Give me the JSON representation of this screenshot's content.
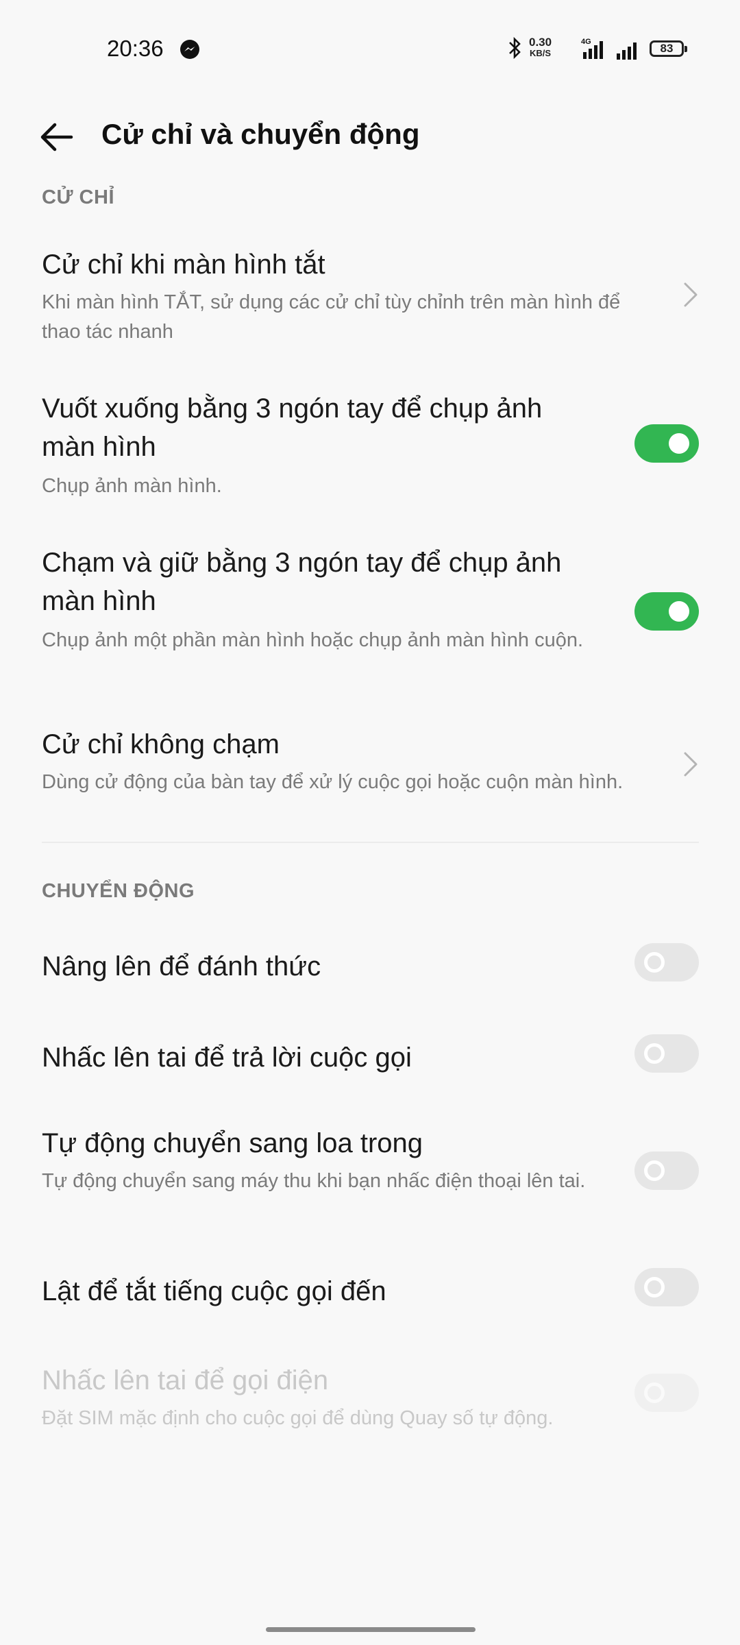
{
  "status_bar": {
    "time": "20:36",
    "net_speed_value": "0.30",
    "net_speed_unit": "KB/S",
    "network_type": "4G",
    "battery": "83",
    "icons": [
      "messenger-icon",
      "bluetooth-icon",
      "signal-icon",
      "signal-icon",
      "battery-icon"
    ]
  },
  "header": {
    "title": "Cử chỉ và chuyển động",
    "back_icon": "arrow-left-icon"
  },
  "sections": {
    "gestures": {
      "label": "CỬ CHỈ",
      "items": [
        {
          "title": "Cử chỉ khi màn hình tắt",
          "subtitle": "Khi màn hình TẮT, sử dụng các cử chỉ tùy chỉnh trên màn hình để thao tác nhanh",
          "control": "chevron"
        },
        {
          "title": "Vuốt xuống bằng 3 ngón tay để chụp ảnh màn hình",
          "subtitle": "Chụp ảnh màn hình.",
          "control": "toggle",
          "enabled": true
        },
        {
          "title": "Chạm và giữ bằng 3 ngón tay để chụp ảnh màn hình",
          "subtitle": "Chụp ảnh một phần màn hình hoặc chụp ảnh màn hình cuộn.",
          "control": "toggle",
          "enabled": true
        },
        {
          "title": "Cử chỉ không chạm",
          "subtitle": "Dùng cử động của bàn tay để xử lý cuộc gọi hoặc cuộn màn hình.",
          "control": "chevron"
        }
      ]
    },
    "motion": {
      "label": "CHUYỂN ĐỘNG",
      "items": [
        {
          "title": "Nâng lên để đánh thức",
          "control": "toggle",
          "enabled": false
        },
        {
          "title": "Nhấc lên tai để trả lời cuộc gọi",
          "control": "toggle",
          "enabled": false
        },
        {
          "title": "Tự động chuyển sang loa trong",
          "subtitle": "Tự động chuyển sang máy thu khi bạn nhấc điện thoại lên tai.",
          "control": "toggle",
          "enabled": false
        },
        {
          "title": "Lật để tắt tiếng cuộc gọi đến",
          "control": "toggle",
          "enabled": false
        },
        {
          "title": "Nhấc lên tai để gọi điện",
          "subtitle": "Đặt SIM mặc định cho cuộc gọi để dùng Quay số tự động.",
          "control": "toggle",
          "enabled": false,
          "disabled": true
        }
      ]
    }
  },
  "colors": {
    "toggle_on": "#32b652",
    "toggle_off": "#e6e6e6",
    "section_label": "#7a7a7a",
    "background": "#f8f8f8"
  }
}
